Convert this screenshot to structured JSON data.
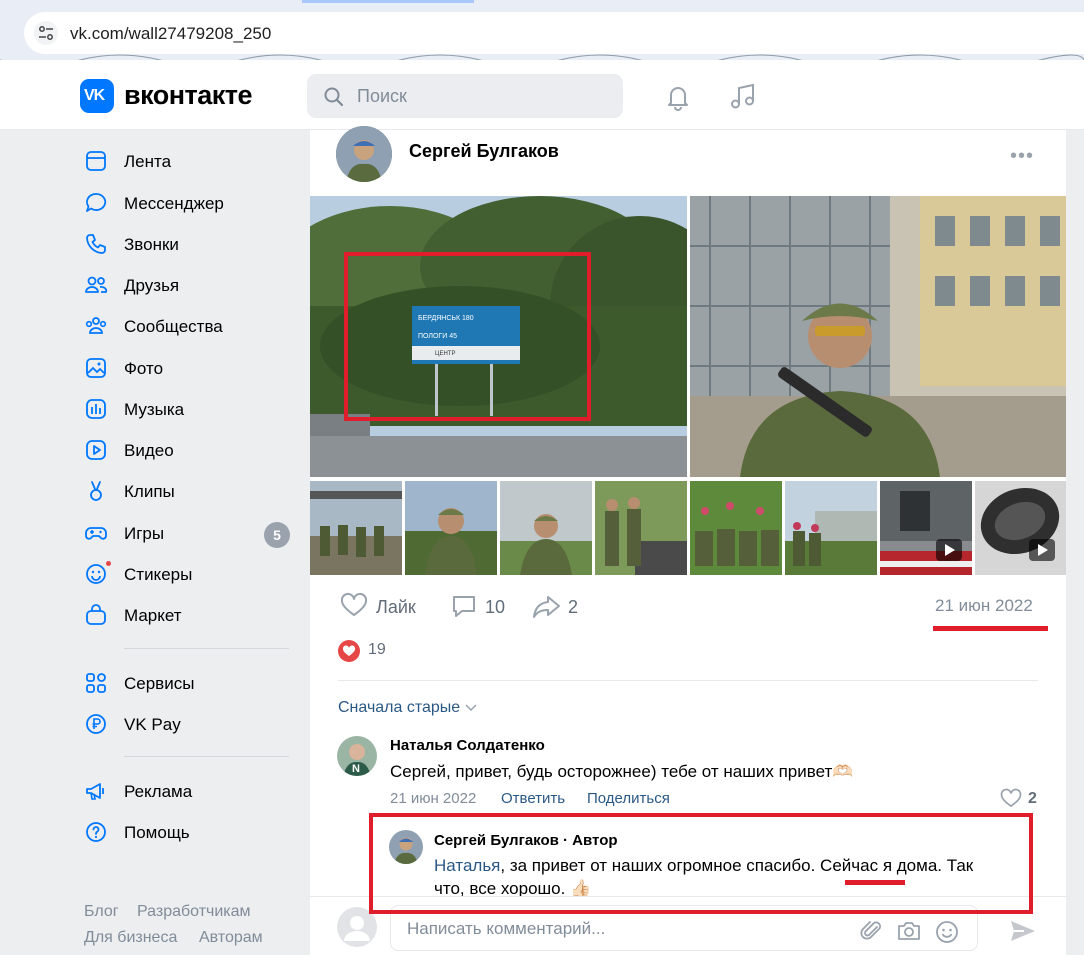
{
  "browser": {
    "url": "vk.com/wall27479208_250"
  },
  "header": {
    "logo_mark": "VK",
    "logo_text": "вконтакте",
    "search_placeholder": "Поиск"
  },
  "sidebar": {
    "items": [
      {
        "label": "Лента",
        "icon": "feed-icon"
      },
      {
        "label": "Мессенджер",
        "icon": "messenger-icon"
      },
      {
        "label": "Звонки",
        "icon": "phone-icon"
      },
      {
        "label": "Друзья",
        "icon": "friends-icon"
      },
      {
        "label": "Сообщества",
        "icon": "communities-icon"
      },
      {
        "label": "Фото",
        "icon": "photo-icon"
      },
      {
        "label": "Музыка",
        "icon": "music-icon"
      },
      {
        "label": "Видео",
        "icon": "video-icon"
      },
      {
        "label": "Клипы",
        "icon": "clips-icon"
      },
      {
        "label": "Игры",
        "icon": "games-icon",
        "badge": "5"
      },
      {
        "label": "Стикеры",
        "icon": "stickers-icon"
      },
      {
        "label": "Маркет",
        "icon": "market-icon"
      }
    ],
    "secondary": [
      {
        "label": "Сервисы",
        "icon": "services-icon"
      },
      {
        "label": "VK Pay",
        "icon": "vkpay-icon"
      }
    ],
    "tertiary": [
      {
        "label": "Реклама",
        "icon": "ads-icon"
      },
      {
        "label": "Помощь",
        "icon": "help-icon"
      }
    ],
    "footer": [
      "Блог",
      "Разработчикам",
      "Для бизнеса",
      "Авторам"
    ]
  },
  "post": {
    "author": "Сергей Булгаков",
    "like_label": "Лайк",
    "comments_count": "10",
    "shares_count": "2",
    "date": "21 июн 2022",
    "reactions_count": "19",
    "sign_lines": [
      "БЕРДЯНСЬК 180",
      "ПОЛОГИ 45",
      "ЦЕНТР"
    ]
  },
  "comments": {
    "sort_label": "Сначала старые",
    "items": [
      {
        "author": "Наталья Солдатенко",
        "text": "Сергей, привет, будь осторожнее) тебе от наших привет🫶🏻",
        "date": "21 июн 2022",
        "reply_label": "Ответить",
        "share_label": "Поделиться",
        "likes": "2"
      }
    ],
    "reply": {
      "author": "Сергей Булгаков · Автор",
      "mention": "Наталья",
      "text_line1": ", за привет от наших огромное спасибо. Сейчас я дома. Так",
      "text_line2": "что, все хорошо. 👍🏻"
    },
    "composer_placeholder": "Написать комментарий..."
  },
  "colors": {
    "vk_blue": "#0077ff",
    "link": "#2a5885",
    "annotation_red": "#e01e2b",
    "heart": "#e64646"
  }
}
